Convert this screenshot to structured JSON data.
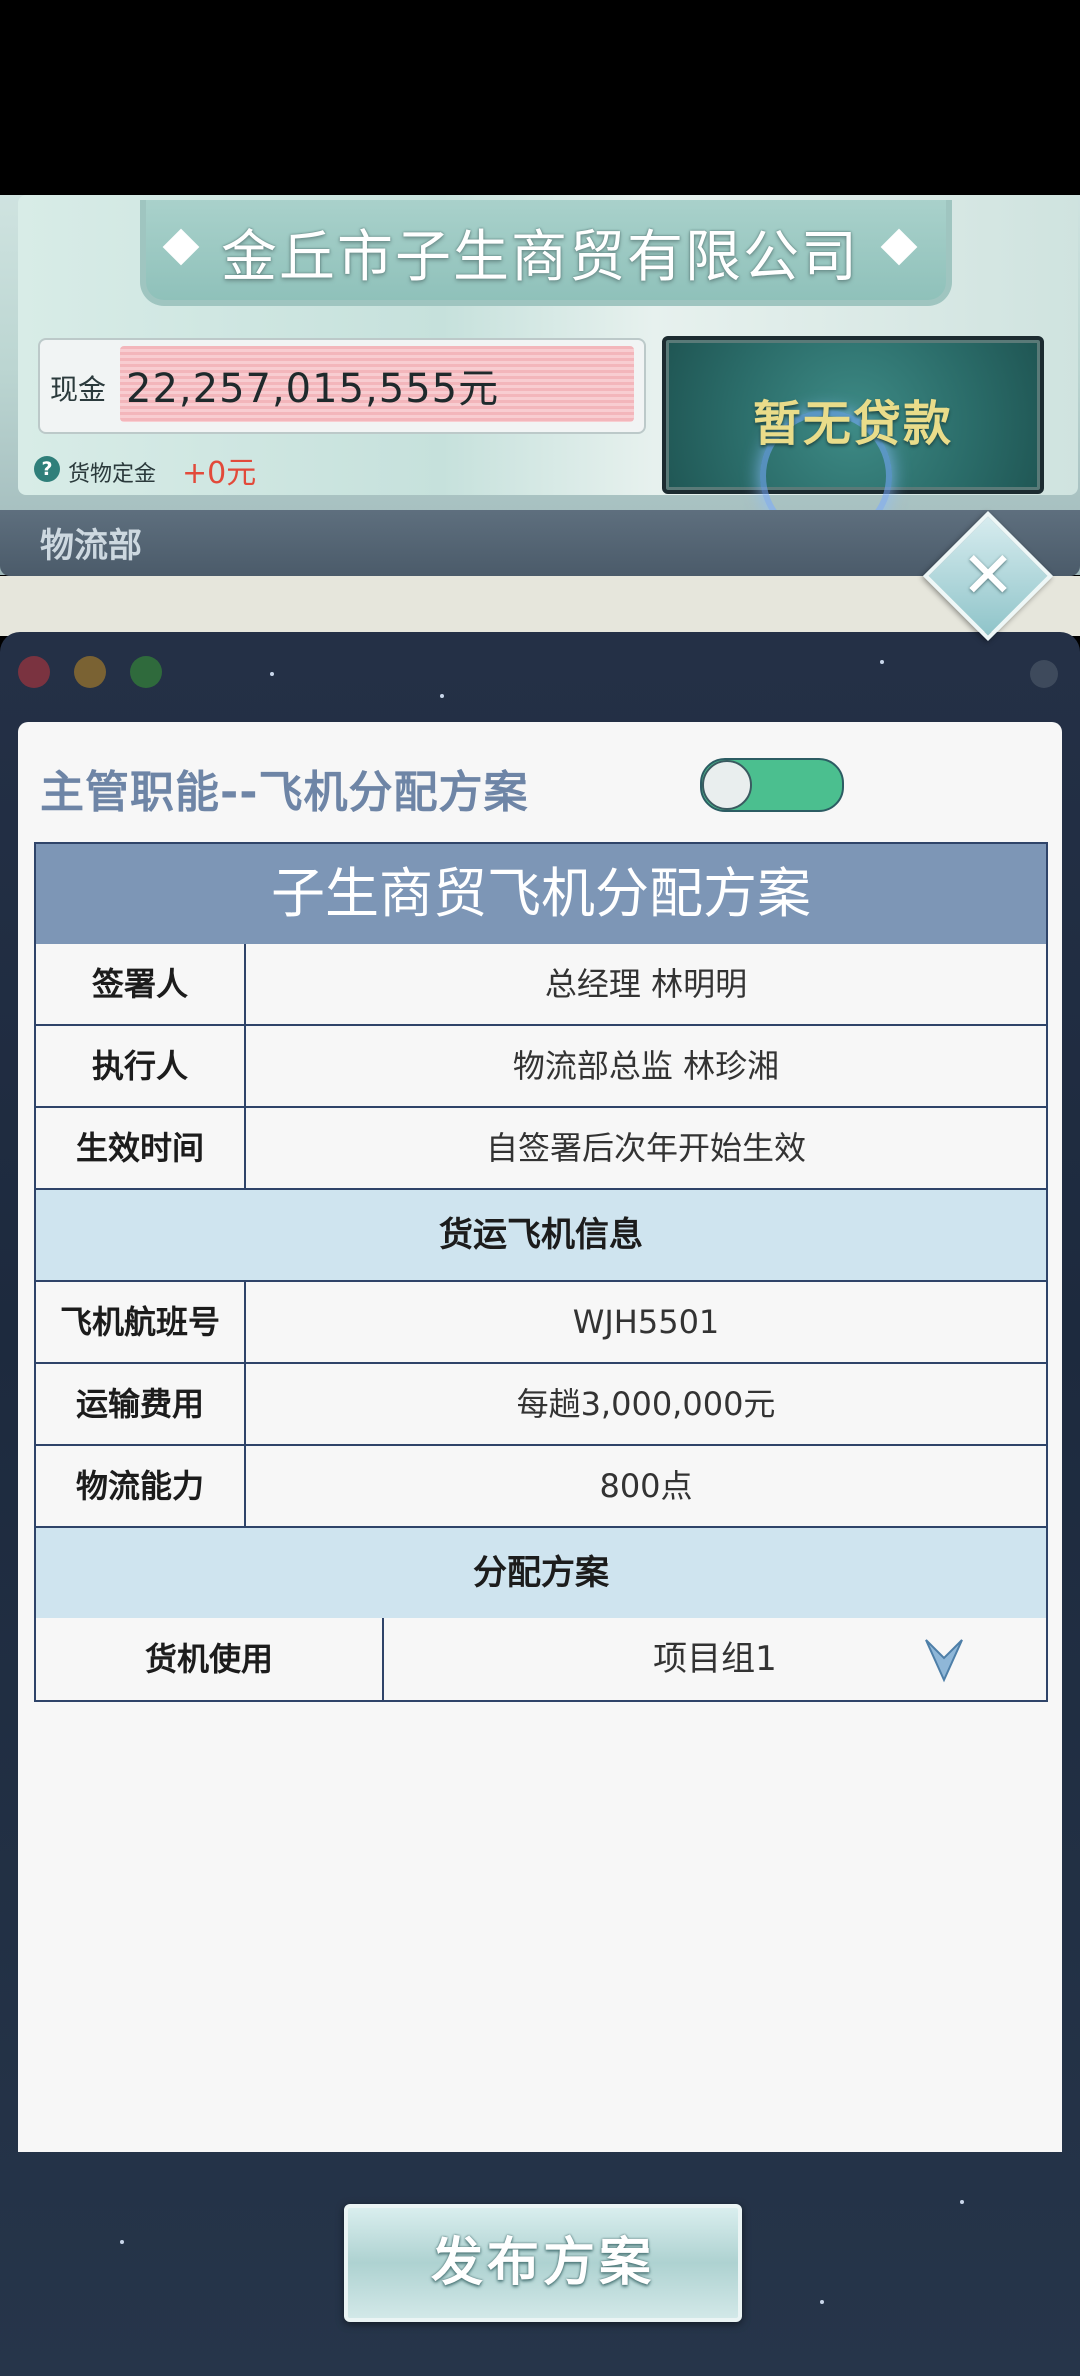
{
  "header": {
    "company_name": "金丘市子生商贸有限公司",
    "cash_label": "现金",
    "cash_value": "22,257,015,555元",
    "deposit_label": "货物定金",
    "deposit_value": "+0元",
    "loan_button": "暂无贷款",
    "department": "物流部"
  },
  "window": {
    "section_title": "主管职能--飞机分配方案",
    "toggle_on": true
  },
  "plan_table": {
    "title": "子生商贸飞机分配方案",
    "rows_top": [
      {
        "key": "签署人",
        "value": "总经理 林明明"
      },
      {
        "key": "执行人",
        "value": "物流部总监 林珍湘"
      },
      {
        "key": "生效时间",
        "value": "自签署后次年开始生效"
      }
    ],
    "section_cargo": "货运飞机信息",
    "rows_cargo": [
      {
        "key": "飞机航班号",
        "value": "WJH5501"
      },
      {
        "key": "运输费用",
        "value": "每趟3,000,000元"
      },
      {
        "key": "物流能力",
        "value": "800点"
      }
    ],
    "section_plan": "分配方案",
    "assign": {
      "key": "货机使用",
      "value": "项目组1"
    }
  },
  "actions": {
    "publish": "发布方案"
  },
  "colors": {
    "accent_title": "#6e85a6",
    "table_header": "#7d96b6",
    "section_bg": "#cfe4ef",
    "toggle_on": "#4bbf8f",
    "deposit_red": "#e24a3a",
    "loan_text": "#e9dc8a"
  }
}
